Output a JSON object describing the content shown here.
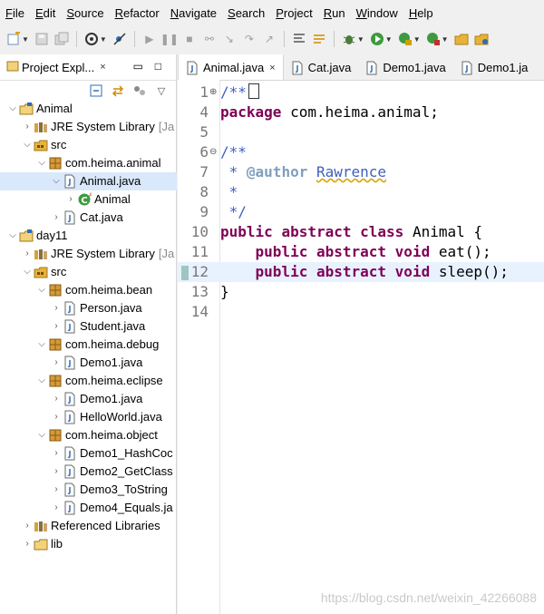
{
  "menubar": {
    "items": [
      "File",
      "Edit",
      "Source",
      "Refactor",
      "Navigate",
      "Search",
      "Project",
      "Run",
      "Window",
      "Help"
    ]
  },
  "explorer": {
    "title": "Project Expl...",
    "close_icon": "×",
    "tree": [
      {
        "label": "Animal",
        "twist": "open",
        "icon": "project-icon"
      },
      {
        "label": "JRE System Library",
        "suffix": "[Ja",
        "twist": "closed",
        "icon": "library-icon"
      },
      {
        "label": "src",
        "twist": "open",
        "icon": "source-folder-icon"
      },
      {
        "label": "com.heima.animal",
        "twist": "open",
        "icon": "package-icon"
      },
      {
        "label": "Animal.java",
        "twist": "open",
        "icon": "java-file-icon",
        "selected": true
      },
      {
        "label": "Animal",
        "twist": "closed",
        "icon": "class-icon"
      },
      {
        "label": "Cat.java",
        "twist": "closed",
        "icon": "java-file-icon"
      },
      {
        "label": "day11",
        "twist": "open",
        "icon": "project-icon"
      },
      {
        "label": "JRE System Library",
        "suffix": "[Ja",
        "twist": "closed",
        "icon": "library-icon"
      },
      {
        "label": "src",
        "twist": "open",
        "icon": "source-folder-icon"
      },
      {
        "label": "com.heima.bean",
        "twist": "open",
        "icon": "package-icon"
      },
      {
        "label": "Person.java",
        "twist": "closed",
        "icon": "java-file-icon"
      },
      {
        "label": "Student.java",
        "twist": "closed",
        "icon": "java-file-icon"
      },
      {
        "label": "com.heima.debug",
        "twist": "open",
        "icon": "package-icon"
      },
      {
        "label": "Demo1.java",
        "twist": "closed",
        "icon": "java-file-icon"
      },
      {
        "label": "com.heima.eclipse",
        "twist": "open",
        "icon": "package-icon"
      },
      {
        "label": "Demo1.java",
        "twist": "closed",
        "icon": "java-file-icon"
      },
      {
        "label": "HelloWorld.java",
        "twist": "closed",
        "icon": "java-file-icon"
      },
      {
        "label": "com.heima.object",
        "twist": "open",
        "icon": "package-icon"
      },
      {
        "label": "Demo1_HashCoc",
        "twist": "closed",
        "icon": "java-file-icon"
      },
      {
        "label": "Demo2_GetClass",
        "twist": "closed",
        "icon": "java-file-icon"
      },
      {
        "label": "Demo3_ToString",
        "twist": "closed",
        "icon": "java-file-icon"
      },
      {
        "label": "Demo4_Equals.ja",
        "twist": "closed",
        "icon": "java-file-icon"
      },
      {
        "label": "Referenced Libraries",
        "twist": "closed",
        "icon": "library-icon"
      },
      {
        "label": "lib",
        "twist": "closed",
        "icon": "folder-icon"
      }
    ]
  },
  "editor": {
    "tabs": [
      {
        "label": "Animal.java",
        "active": true,
        "close": "×"
      },
      {
        "label": "Cat.java",
        "active": false
      },
      {
        "label": "Demo1.java",
        "active": false
      },
      {
        "label": "Demo1.ja",
        "active": false
      }
    ],
    "lines": [
      {
        "num": "1",
        "fold": "⊕",
        "tokens": [
          {
            "t": "/**",
            "c": "cm"
          }
        ],
        "caret": true
      },
      {
        "num": "4",
        "tokens": [
          {
            "t": "package",
            "c": "kw"
          },
          {
            "t": " com.heima.animal;",
            "c": ""
          }
        ]
      },
      {
        "num": "5",
        "tokens": []
      },
      {
        "num": "6",
        "fold": "⊖",
        "tokens": [
          {
            "t": "/**",
            "c": "cm"
          }
        ]
      },
      {
        "num": "7",
        "tokens": [
          {
            "t": " * ",
            "c": "cm"
          },
          {
            "t": "@author",
            "c": "tag"
          },
          {
            "t": " ",
            "c": "cm"
          },
          {
            "t": "Rawrence",
            "c": "author"
          }
        ]
      },
      {
        "num": "8",
        "tokens": [
          {
            "t": " *",
            "c": "cm"
          }
        ]
      },
      {
        "num": "9",
        "tokens": [
          {
            "t": " */",
            "c": "cm"
          }
        ]
      },
      {
        "num": "10",
        "tokens": [
          {
            "t": "public",
            "c": "kw"
          },
          {
            "t": " ",
            "c": ""
          },
          {
            "t": "abstract",
            "c": "kw"
          },
          {
            "t": " ",
            "c": ""
          },
          {
            "t": "class",
            "c": "kw"
          },
          {
            "t": " Animal {",
            "c": ""
          }
        ]
      },
      {
        "num": "11",
        "tokens": [
          {
            "t": "    ",
            "c": ""
          },
          {
            "t": "public",
            "c": "kw"
          },
          {
            "t": " ",
            "c": ""
          },
          {
            "t": "abstract",
            "c": "kw"
          },
          {
            "t": " ",
            "c": ""
          },
          {
            "t": "void",
            "c": "kw"
          },
          {
            "t": " eat();",
            "c": ""
          }
        ]
      },
      {
        "num": "12",
        "current": true,
        "changed": true,
        "tokens": [
          {
            "t": "    ",
            "c": ""
          },
          {
            "t": "public",
            "c": "kw"
          },
          {
            "t": " ",
            "c": ""
          },
          {
            "t": "abstract",
            "c": "kw"
          },
          {
            "t": " ",
            "c": ""
          },
          {
            "t": "void",
            "c": "kw"
          },
          {
            "t": " sleep();",
            "c": ""
          }
        ]
      },
      {
        "num": "13",
        "tokens": [
          {
            "t": "}",
            "c": ""
          }
        ]
      },
      {
        "num": "14",
        "tokens": []
      }
    ]
  },
  "watermark": "https://blog.csdn.net/weixin_42266088",
  "colors": {
    "keyword": "#7f0055",
    "javadoc": "#3f5fbf",
    "selection": "#d9e8fb",
    "current_line": "#e8f2fe"
  }
}
